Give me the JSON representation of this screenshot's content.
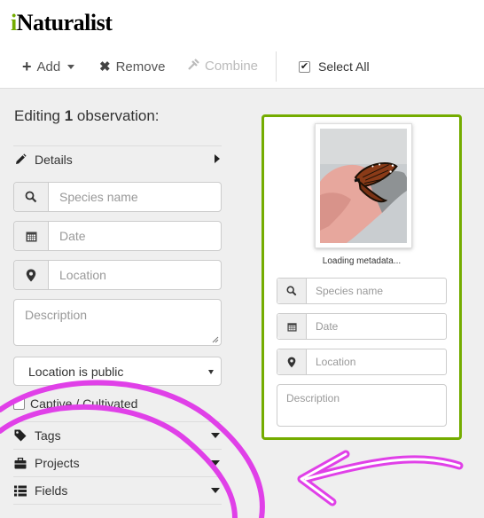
{
  "app": {
    "logo_i": "i",
    "logo_rest": "Naturalist"
  },
  "toolbar": {
    "add_label": "Add",
    "remove_label": "Remove",
    "combine_label": "Combine",
    "select_all_label": "Select All",
    "select_all_checked": true
  },
  "editing": {
    "prefix": "Editing",
    "count": "1",
    "suffix": "observation:"
  },
  "details": {
    "label": "Details",
    "species_placeholder": "Species name",
    "date_placeholder": "Date",
    "location_placeholder": "Location",
    "description_placeholder": "Description",
    "geoprivacy_value": "Location is public",
    "captive_label": "Captive / Cultivated"
  },
  "sections": [
    {
      "label": "Tags",
      "icon": "tag-icon"
    },
    {
      "label": "Projects",
      "icon": "briefcase-icon"
    },
    {
      "label": "Fields",
      "icon": "list-icon"
    }
  ],
  "card": {
    "loading_text": "Loading metadata...",
    "species_placeholder": "Species name",
    "date_placeholder": "Date",
    "location_placeholder": "Location",
    "description_placeholder": "Description"
  },
  "colors": {
    "accent": "#74ac00",
    "annotation": "#e040e8"
  }
}
